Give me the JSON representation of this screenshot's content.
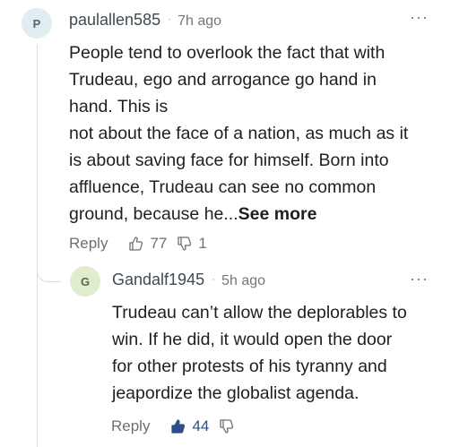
{
  "comment": {
    "avatar_letter": "P",
    "username": "paulallen585",
    "separator": "·",
    "time": "7h ago",
    "more_icon": "···",
    "body_lines": [
      "People tend to overlook the fact that with",
      "Trudeau, ego and arrogance go hand in",
      "hand. This is",
      "not about the face of a nation, as much as it",
      "is about saving face for himself. Born into",
      "affluence, Trudeau can see no common",
      "ground, because he..."
    ],
    "see_more": "See more",
    "actions": {
      "reply": "Reply",
      "likes": "77",
      "dislikes": "1"
    }
  },
  "reply": {
    "avatar_letter": "G",
    "username": "Gandalf1945",
    "separator": "·",
    "time": "5h ago",
    "more_icon": "···",
    "body_lines": [
      "Trudeau can’t allow the deplorables to",
      "win. If he did, it would open the door",
      "for other protests of his tyranny and",
      "jeapordize the globalist agenda."
    ],
    "actions": {
      "reply": "Reply",
      "likes": "44"
    },
    "liked": true
  },
  "colors": {
    "accent_like": "#2b4f86",
    "muted": "#6f6f6f",
    "thread_line": "#dcdcdc"
  }
}
